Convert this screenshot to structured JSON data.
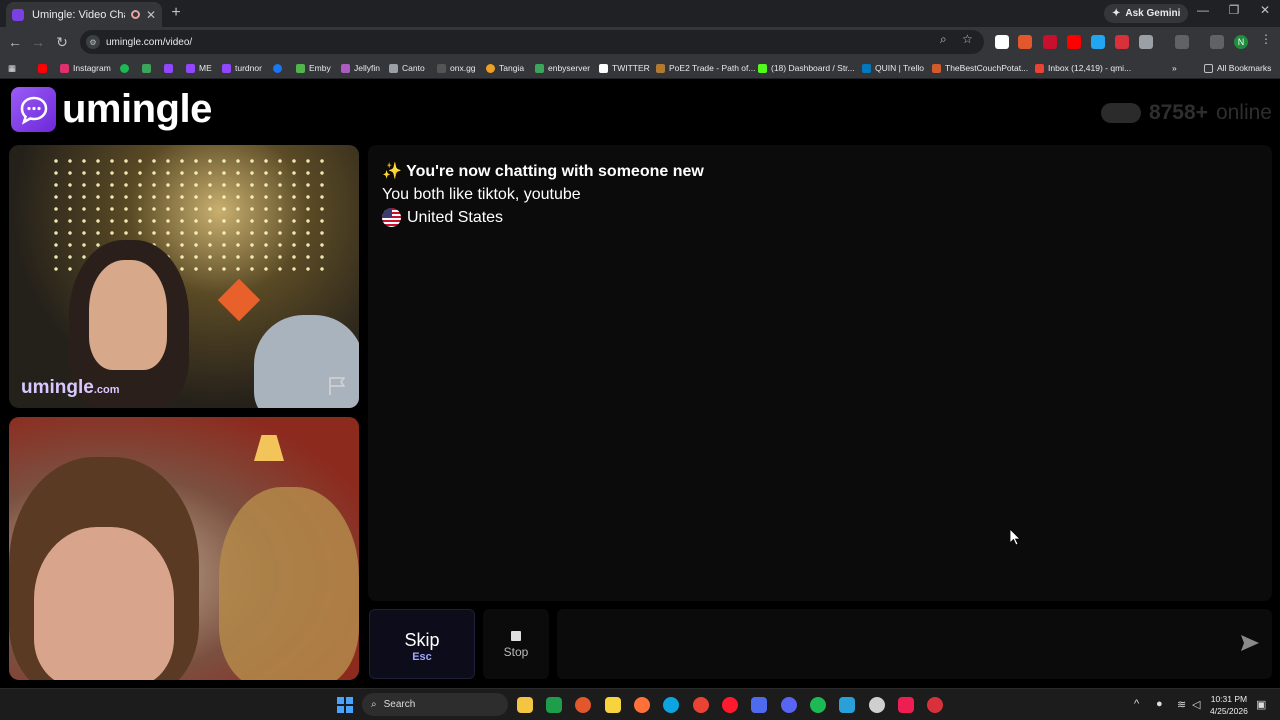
{
  "browser": {
    "tab_title": "Umingle: Video Chat with S",
    "new_tab": "+",
    "ask_gemini": "Ask Gemini",
    "url": "umingle.com/video/",
    "bookmarks": [
      "Instagram",
      "ME",
      "turdnor",
      "Emby",
      "Jellyfin",
      "Canto",
      "onx.gg",
      "Tangia",
      "enbyserver",
      "TWITTER",
      "PoE2 Trade - Path of...",
      "(18) Dashboard / Str...",
      "QUIN | Trello",
      "TheBestCouchPotat...",
      "Inbox (12,419) - qmi..."
    ],
    "all_bookmarks": "All Bookmarks",
    "profile_initial": "N"
  },
  "site": {
    "logo_text": "umingle",
    "online_count": "8758+",
    "online_label": "online"
  },
  "stranger_video": {
    "watermark_main": "umingle",
    "watermark_suffix": ".com"
  },
  "chat": {
    "status_emoji": "✨",
    "status": "You're now chatting with someone new",
    "interests": "You both like tiktok, youtube",
    "country": "United States"
  },
  "controls": {
    "skip_label": "Skip",
    "skip_key": "Esc",
    "stop_label": "Stop"
  },
  "taskbar": {
    "search_label": "Search",
    "time": "10:31 PM",
    "date": "4/25/2026"
  },
  "colors": {
    "brand": "#7c3aed",
    "skip_key": "#9fa8ff"
  }
}
